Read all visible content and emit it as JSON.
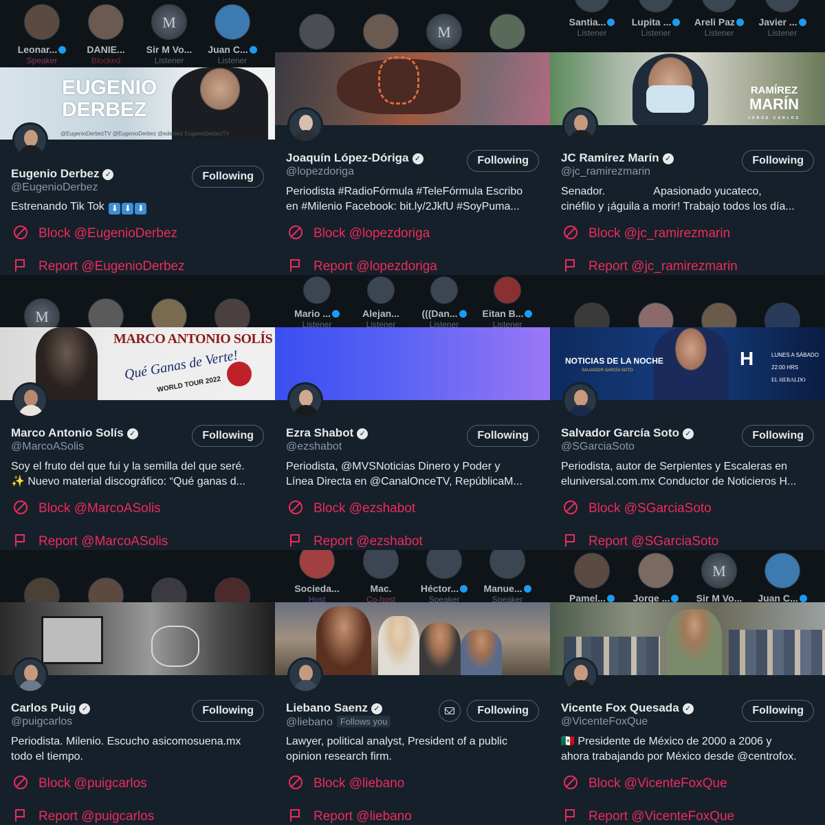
{
  "cards": [
    {
      "listeners": [
        {
          "name": "Leonar...",
          "role": "Speaker"
        },
        {
          "name": "DANIE...",
          "role": "Blocked"
        },
        {
          "name": "Sir M Vo...",
          "role": "Listener",
          "avatar_text": "M"
        },
        {
          "name": "Juan C...",
          "role": "Listener"
        }
      ],
      "banner_text": [
        "EUGENIO",
        "DERBEZ"
      ],
      "banner_small_text": "@EugenioDerbezTV   @EugenioDerbez   @ederbez   EugenioDerbezTV",
      "name": "Eugenio Derbez",
      "handle": "@EugenioDerbez",
      "follow_label": "Following",
      "bio": [
        "Estrenando Tik Tok"
      ],
      "bio_emojis": [
        "⬇",
        "⬇",
        "⬇"
      ],
      "block_label": "Block @EugenioDerbez",
      "report_label": "Report @EugenioDerbez"
    },
    {
      "listeners": [
        {
          "name": "",
          "role": ""
        },
        {
          "name": "",
          "role": ""
        },
        {
          "name": "",
          "role": "",
          "avatar_text": "M"
        },
        {
          "name": "",
          "role": ""
        }
      ],
      "name": "Joaquín López-Dóriga",
      "handle": "@lopezdoriga",
      "follow_label": "Following",
      "bio": [
        "Periodista #RadioFórmula #TeleFórmula Escribo",
        "en #Milenio Facebook: bit.ly/2JkfU #SoyPuma..."
      ],
      "block_label": "Block @lopezdoriga",
      "report_label": "Report @lopezdoriga"
    },
    {
      "listeners": [
        {
          "name": "Santia...",
          "role": "Listener"
        },
        {
          "name": "Lupita ...",
          "role": "Listener"
        },
        {
          "name": "Areli Paz",
          "role": "Listener"
        },
        {
          "name": "Javier ...",
          "role": "Listener"
        }
      ],
      "banner_text": [
        "RAMÍREZ",
        "MARÍN"
      ],
      "banner_small_text": "JORGE CARLOS",
      "name": "JC Ramírez Marín",
      "handle": "@jc_ramirezmarin",
      "follow_label": "Following",
      "bio": [
        "Senador.                Apasionado yucateco,",
        "cinéfilo y ¡águila a morir! Trabajo todos los día..."
      ],
      "block_label": "Block @jc_ramirezmarin",
      "report_label": "Report @jc_ramirezmarin"
    },
    {
      "listeners": [
        {
          "name": "",
          "role": "",
          "avatar_text": "M"
        },
        {
          "name": "",
          "role": ""
        },
        {
          "name": "",
          "role": ""
        },
        {
          "name": "",
          "role": ""
        }
      ],
      "banner_text": [
        "MARCO ANTONIO SOLÍS"
      ],
      "banner_small_text": "Qué Ganas de Verte!",
      "banner_tour": "WORLD TOUR 2022",
      "name": "Marco Antonio Solís",
      "handle": "@MarcoASolis",
      "follow_label": "Following",
      "bio": [
        "Soy el fruto del que fui y la semilla del que seré.",
        "✨ Nuevo material discográfico: “Qué ganas d..."
      ],
      "block_label": "Block @MarcoASolis",
      "report_label": "Report @MarcoASolis"
    },
    {
      "listeners": [
        {
          "name": "Mario ...",
          "role": "Listener"
        },
        {
          "name": "Alejan...",
          "role": "Listener"
        },
        {
          "name": "(((Dan...",
          "role": "Listener"
        },
        {
          "name": "Eitan B...",
          "role": "Listener"
        }
      ],
      "name": "Ezra Shabot",
      "handle": "@ezshabot",
      "follow_label": "Following",
      "bio": [
        "Periodista, @MVSNoticias Dinero y Poder y",
        "Línea Directa en @CanalOnceTV, RepúblicaM..."
      ],
      "block_label": "Block @ezshabot",
      "report_label": "Report @ezshabot"
    },
    {
      "listeners": [
        {
          "name": "",
          "role": ""
        },
        {
          "name": "",
          "role": ""
        },
        {
          "name": "",
          "role": ""
        },
        {
          "name": "",
          "role": ""
        }
      ],
      "banner_text": [
        "NOTICIAS DE LA NOCHE"
      ],
      "banner_small_text": "SALVADOR GARCÍA SOTO",
      "banner_right": [
        "LUNES A SÁBADO",
        "22:00 HRS",
        "EL HERALDO"
      ],
      "name": "Salvador García Soto",
      "handle": "@SGarciaSoto",
      "follow_label": "Following",
      "bio": [
        "Periodista, autor de Serpientes y Escaleras en",
        "eluniversal.com.mx Conductor de Noticieros H..."
      ],
      "block_label": "Block @SGarciaSoto",
      "report_label": "Report @SGarciaSoto"
    },
    {
      "listeners": [
        {
          "name": "",
          "role": ""
        },
        {
          "name": "",
          "role": ""
        },
        {
          "name": "",
          "role": ""
        },
        {
          "name": "",
          "role": ""
        }
      ],
      "name": "Carlos Puig",
      "handle": "@puigcarlos",
      "follow_label": "Following",
      "bio": [
        "Periodista. Milenio. Escucho asicomosuena.mx",
        "todo el tiempo."
      ],
      "block_label": "Block @puigcarlos",
      "report_label": "Report @puigcarlos"
    },
    {
      "listeners": [
        {
          "name": "Socieda...",
          "role": "Host"
        },
        {
          "name": "Mac.",
          "role": "Co-host"
        },
        {
          "name": "Héctor...",
          "role": "Speaker"
        },
        {
          "name": "Manue...",
          "role": "Speaker"
        }
      ],
      "name": "Liebano Saenz",
      "handle": "@liebano",
      "follows_you": "Follows you",
      "follow_label": "Following",
      "bio": [
        "Lawyer, political analyst, President of a public",
        "opinion research firm."
      ],
      "block_label": "Block @liebano",
      "report_label": "Report @liebano"
    },
    {
      "listeners": [
        {
          "name": "Pamel...",
          "role": ""
        },
        {
          "name": "Jorge ...",
          "role": ""
        },
        {
          "name": "Sir M Vo...",
          "role": "",
          "avatar_text": "M"
        },
        {
          "name": "Juan C...",
          "role": ""
        }
      ],
      "name": "Vicente Fox Quesada",
      "handle": "@VicenteFoxQue",
      "follow_label": "Following",
      "bio": [
        "🇲🇽 Presidente de México de 2000 a 2006 y",
        "ahora trabajando por México desde @centrofox."
      ],
      "block_label": "Block @VicenteFoxQue",
      "report_label": "Report @VicenteFoxQue"
    }
  ],
  "colors": {
    "background": "#15202b",
    "danger": "#ef2b5b",
    "text": "#e7e9ea",
    "secondary": "#8b98a5"
  }
}
